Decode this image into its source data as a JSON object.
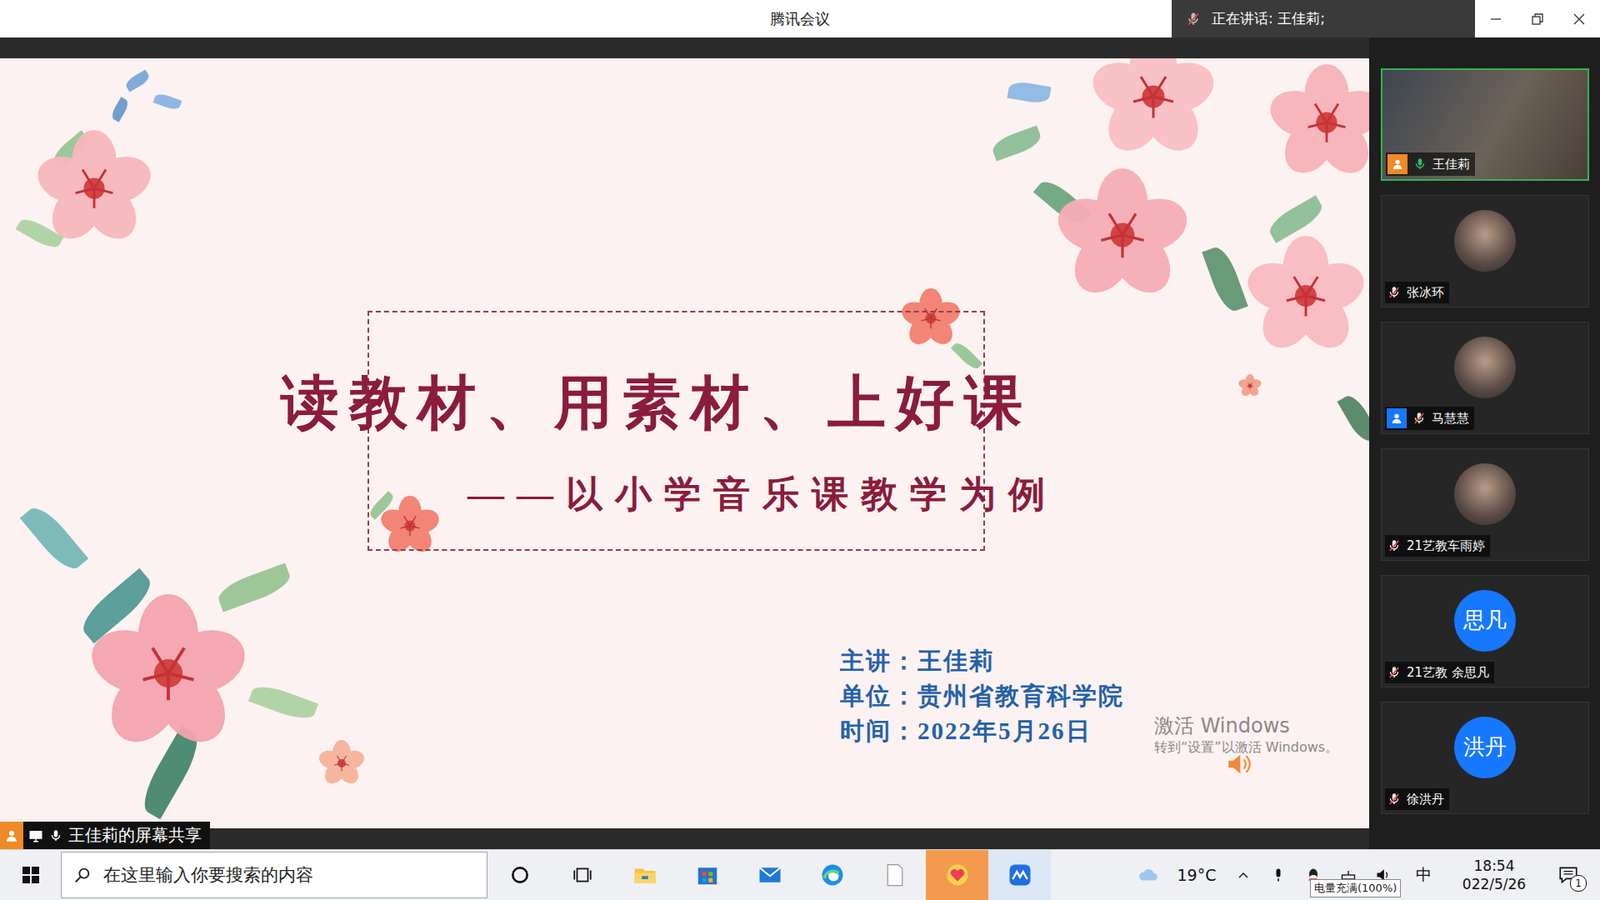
{
  "window": {
    "title": "腾讯会议",
    "speaking": "正在讲话: 王佳莉;"
  },
  "slide": {
    "title": "读教材、用素材、上好课",
    "subtitle": "——以小学音乐课教学为例",
    "info": [
      {
        "label": "主讲：",
        "value": "王佳莉"
      },
      {
        "label": "单位：",
        "value": "贵州省教育科学院"
      },
      {
        "label": "时间：",
        "value": "2022年5月26日"
      }
    ],
    "watermark": {
      "title": "激活 Windows",
      "hint": "转到“设置”以激活 Windows。"
    }
  },
  "share_label": "王佳莉的屏幕共享",
  "participants": [
    {
      "name": "王佳莉",
      "kind": "video",
      "role": "host",
      "muted": false,
      "selected": true
    },
    {
      "name": "张冰环",
      "kind": "photo",
      "role": "member",
      "muted": true,
      "selected": false
    },
    {
      "name": "马慧慧",
      "kind": "photo",
      "role": "cohost",
      "muted": true,
      "selected": false
    },
    {
      "name": "21艺教车雨婷",
      "kind": "photo",
      "role": "member",
      "muted": true,
      "selected": false
    },
    {
      "name": "21艺教 余思凡",
      "kind": "text",
      "avatar": "思凡",
      "role": "member",
      "muted": true,
      "selected": false
    },
    {
      "name": "徐洪丹",
      "kind": "text",
      "avatar": "洪丹",
      "role": "member",
      "muted": true,
      "selected": false
    }
  ],
  "taskbar": {
    "search_placeholder": "在这里输入你要搜索的内容",
    "apps": [
      {
        "kind": "cortana",
        "active": false
      },
      {
        "kind": "taskview",
        "active": false
      },
      {
        "kind": "explorer",
        "active": false
      },
      {
        "kind": "store",
        "active": false
      },
      {
        "kind": "mail",
        "active": false
      },
      {
        "kind": "edge",
        "active": false
      },
      {
        "kind": "file",
        "active": false
      },
      {
        "kind": "heart",
        "active": true,
        "color": "#f39a4e"
      },
      {
        "kind": "meeting",
        "active": true,
        "color": "#dce8f6"
      }
    ],
    "weather": "19°C",
    "ime": "中",
    "time": "18:54",
    "date": "022/5/26",
    "tooltip": "电量充满(100%)",
    "notifications": "1"
  }
}
